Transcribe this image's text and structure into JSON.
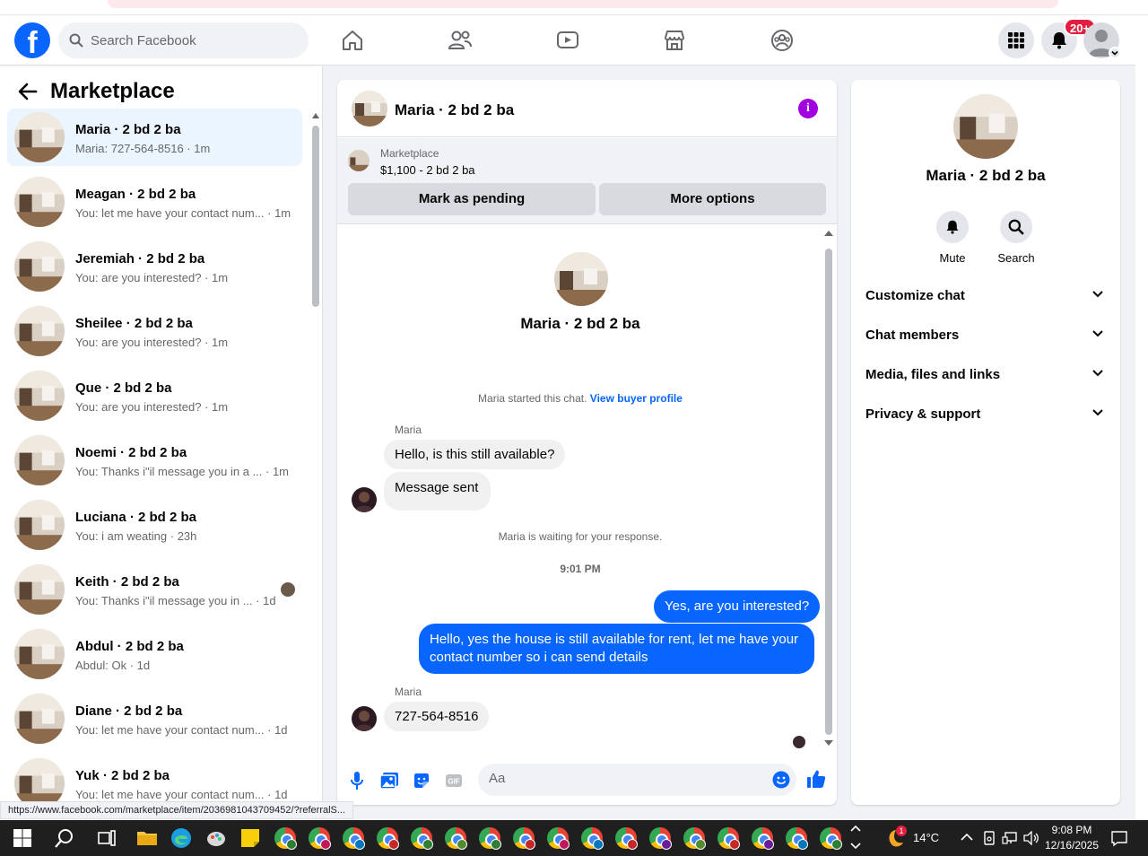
{
  "topbar": {
    "search_placeholder": "Search Facebook",
    "notification_count": "20+",
    "logo_letter": "f"
  },
  "sidebar": {
    "title": "Marketplace",
    "conversations": [
      {
        "name": "Maria · 2 bd 2 ba",
        "preview": "Maria: 727-564-8516 · 1m",
        "active": true
      },
      {
        "name": "Meagan · 2 bd 2 ba",
        "preview": "You: let me have your contact num... · 1m"
      },
      {
        "name": "Jeremiah · 2 bd 2 ba",
        "preview": "You: are you interested? · 1m"
      },
      {
        "name": "Sheilee · 2 bd 2 ba",
        "preview": "You: are you interested? · 1m"
      },
      {
        "name": "Que · 2 bd 2 ba",
        "preview": "You: are you interested? · 1m"
      },
      {
        "name": "Noemi · 2 bd 2 ba",
        "preview": "You: Thanks i\"il message you in a ... · 1m"
      },
      {
        "name": "Luciana · 2 bd 2 ba",
        "preview": "You: i am weating · 23h"
      },
      {
        "name": "Keith · 2 bd 2 ba",
        "preview": "You: Thanks i\"il message you in ... · 1d"
      },
      {
        "name": "Abdul · 2 bd 2 ba",
        "preview": "Abdul: Ok · 1d"
      },
      {
        "name": "Diane · 2 bd 2 ba",
        "preview": "You: let me have your contact num... · 1d"
      },
      {
        "name": "Yuk · 2 bd 2 ba",
        "preview": "You: let me have your contact num... · 1d"
      }
    ]
  },
  "chat": {
    "title": "Maria · 2 bd 2 ba",
    "info_glyph": "i",
    "marketplace_label": "Marketplace",
    "listing": "$1,100 - 2 bd 2 ba",
    "mark_pending": "Mark as pending",
    "more_options": "More options",
    "intro_name": "Maria · 2 bd 2 ba",
    "started_text": "Maria started this chat.",
    "view_buyer": "View buyer profile",
    "sender_name": "Maria",
    "msg_in_1": "Hello, is this still available?",
    "msg_in_2": "Message sent",
    "waiting_text": "Maria is waiting for your response.",
    "timestamp": "9:01 PM",
    "msg_out_1": "Yes, are you interested?",
    "msg_out_2": "Hello, yes the house is still available for rent, let me have your contact number so i can send details",
    "sender_name_2": "Maria",
    "msg_in_3": "727-564-8516",
    "composer_placeholder": "Aa",
    "gif_label": "GIF"
  },
  "details": {
    "name": "Maria · 2 bd 2 ba",
    "mute_label": "Mute",
    "search_label": "Search",
    "sections": [
      "Customize chat",
      "Chat members",
      "Media, files and links",
      "Privacy & support"
    ]
  },
  "status_url": "https://www.facebook.com/marketplace/item/2036981043709452/?referralS...",
  "taskbar": {
    "weather_temp": "14°C",
    "weather_alert": "1",
    "time": "9:08 PM",
    "date": "12/16/2025"
  },
  "colors": {
    "brand": "#0866ff",
    "accent_purple": "#a200e0",
    "badge_red": "#e41e3f"
  }
}
